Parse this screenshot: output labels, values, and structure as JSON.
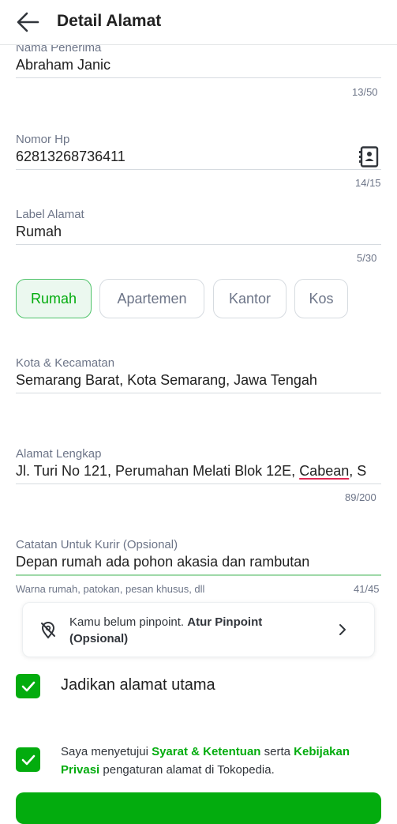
{
  "header": {
    "title": "Detail Alamat",
    "back_icon": "arrow-left-icon"
  },
  "form": {
    "recipient": {
      "label": "Nama Penerima",
      "value": "Abraham Janic",
      "counter": "13/50"
    },
    "phone": {
      "label": "Nomor Hp",
      "value": "62813268736411",
      "counter": "14/15",
      "icon": "contact-book-icon"
    },
    "address_label": {
      "label": "Label Alamat",
      "value": "Rumah",
      "counter": "5/30",
      "chips": [
        "Rumah",
        "Apartemen",
        "Kantor",
        "Kos"
      ],
      "selected": "Rumah"
    },
    "city": {
      "label": "Kota & Kecamatan",
      "value": "Semarang Barat, Kota Semarang, Jawa Tengah"
    },
    "full_address": {
      "label": "Alamat Lengkap",
      "value_part1": "Jl. Turi No 121, Perumahan Melati Blok 12E, ",
      "value_part2": "Cabean",
      "value_part3": ", S",
      "counter": "89/200"
    },
    "courier_note": {
      "label": "Catatan Untuk Kurir (Opsional)",
      "value": "Depan rumah ada pohon akasia dan rambutan",
      "helper": "Warna rumah, patokan, pesan khusus, dll",
      "counter": "41/45"
    }
  },
  "pinpoint": {
    "text": "Kamu belum pinpoint.",
    "bold": "Atur Pinpoint (Opsional)",
    "icon": "location-off-icon"
  },
  "main_address": {
    "label": "Jadikan alamat utama",
    "checked": true
  },
  "agreement": {
    "checked": true,
    "t1": "Saya menyetujui ",
    "link1": "Syarat & Ketentuan",
    "t2": " serta ",
    "link2": "Kebijakan Privasi",
    "t3": " pengaturan alamat di Tokopedia."
  },
  "colors": {
    "accent": "#03ac0e",
    "text": "#212121",
    "muted": "#6d7588"
  }
}
